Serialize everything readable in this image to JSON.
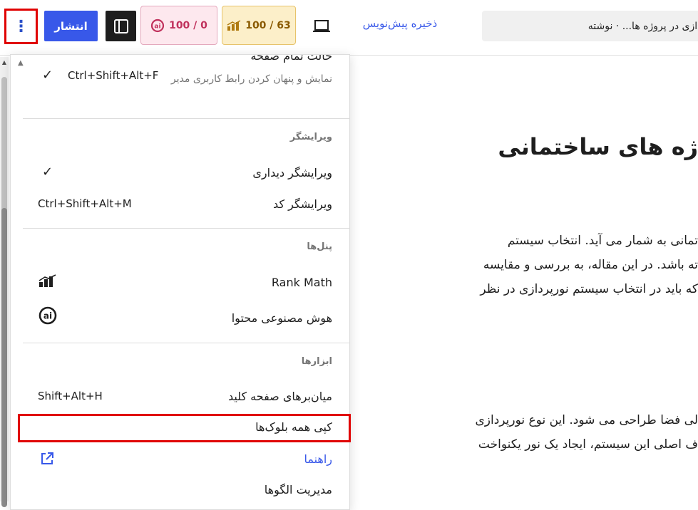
{
  "toolbar": {
    "more_label": "⋮",
    "publish_label": "انتشار",
    "ai_score": "100 / 0",
    "rank_math_score": "100 / 63",
    "save_draft_label": "ذخیره پیش‌نویس",
    "document_title": "پردازی در پروژه ها... · نوشته"
  },
  "editor": {
    "title": "ژه های ساختمانی",
    "paragraph_1": [
      "تمانی به شمار می آید. انتخاب سیستم",
      "ته باشد. در این مقاله، به بررسی و مقایسه",
      "که باید در انتخاب سیستم نورپردازی در نظر"
    ],
    "paragraph_2": [
      "لی فضا طراحی می شود. این نوع نورپردازی",
      "ف اصلی این سیستم، ایجاد یک نور یکنواخت"
    ]
  },
  "menu": {
    "fullscreen": {
      "label": "حالت تمام صفحه",
      "description": "نمایش و پنهان کردن رابط کاربری مدیر",
      "shortcut": "Ctrl+Shift+Alt+F",
      "checked": true
    },
    "editor_group": {
      "heading": "ویرایشگر",
      "visual_label": "ویرایشگر دیداری",
      "visual_checked": true,
      "code_label": "ویرایشگر کد",
      "code_shortcut": "Ctrl+Shift+Alt+M"
    },
    "panels_group": {
      "heading": "پنل‌ها",
      "rank_math_label": "Rank Math",
      "ai_label": "هوش مصنوعی محتوا"
    },
    "tools_group": {
      "heading": "ابزارها",
      "shortcuts_label": "میان‌برهای صفحه کلید",
      "shortcuts_shortcut": "Shift+Alt+H",
      "copy_all_label": "کپی همه بلوک‌ها",
      "help_label": "راهنما",
      "patterns_label": "مدیریت الگوها"
    }
  },
  "colors": {
    "accent": "#3858e9",
    "highlight": "#e00000",
    "ai_score_bg": "#fde8ee",
    "rank_score_bg": "#fcefc9"
  },
  "icons": {
    "sidebar": "sidebar-icon",
    "preview": "laptop-icon",
    "rank_math": "rank-math-icon",
    "ai": "content-ai-icon",
    "external": "external-link-icon"
  }
}
